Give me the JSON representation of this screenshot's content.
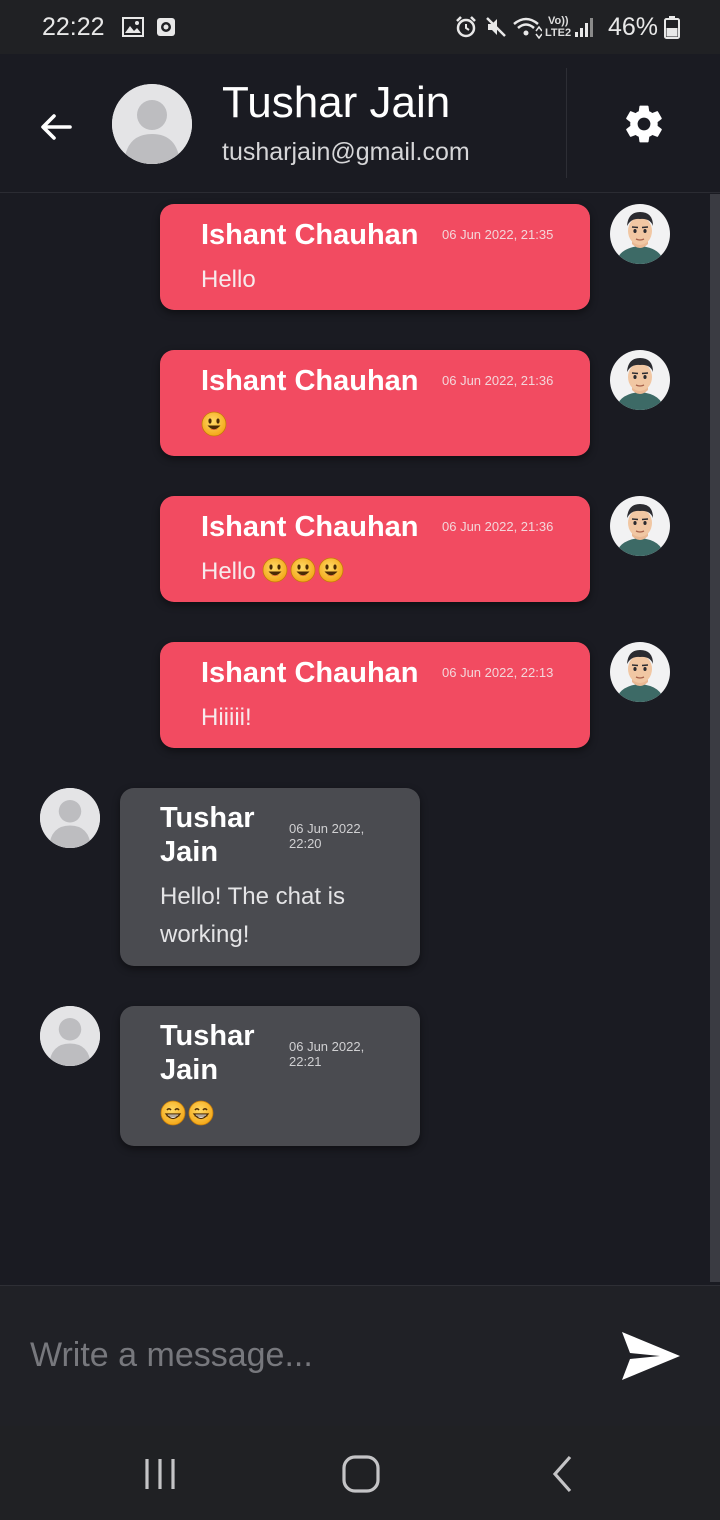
{
  "status_bar": {
    "time": "22:22",
    "volte_top": "Vo))",
    "volte_bottom": "LTE2",
    "battery": "46%",
    "icons": [
      "gallery-icon",
      "record-icon",
      "alarm-icon",
      "mute-icon",
      "wifi-icon",
      "signal-icon",
      "battery-icon"
    ]
  },
  "header": {
    "name": "Tushar Jain",
    "email": "tusharjain@gmail.com",
    "back_icon": "arrow-left-icon",
    "settings_icon": "gear-icon"
  },
  "messages": [
    {
      "sender": "Ishant Chauhan",
      "time": "06 Jun 2022, 21:35",
      "text": "Hello",
      "emoji_count": 0,
      "own": true
    },
    {
      "sender": "Ishant Chauhan",
      "time": "06 Jun 2022, 21:36",
      "text": "",
      "emoji_count": 1,
      "own": true
    },
    {
      "sender": "Ishant Chauhan",
      "time": "06 Jun 2022, 21:36",
      "text": "Hello",
      "emoji_count": 3,
      "own": true
    },
    {
      "sender": "Ishant Chauhan",
      "time": "06 Jun 2022, 22:13",
      "text": "Hiiiii!",
      "emoji_count": 0,
      "own": true
    },
    {
      "sender_line1": "Tushar",
      "sender_line2": "Jain",
      "time_line1": "06 Jun 2022,",
      "time_line2": "22:20",
      "text_line1": "Hello! The chat is",
      "text_line2": "working!",
      "own": false
    },
    {
      "sender_line1": "Tushar",
      "sender_line2": "Jain",
      "time_line1": "06 Jun 2022,",
      "time_line2": "22:21",
      "emoji_count": 2,
      "own": false
    }
  ],
  "composer": {
    "placeholder": "Write a message...",
    "send_icon": "send-icon"
  },
  "colors": {
    "own_bubble": "#f24b61",
    "other_bubble": "#4a4b50",
    "background": "#1a1b22"
  }
}
